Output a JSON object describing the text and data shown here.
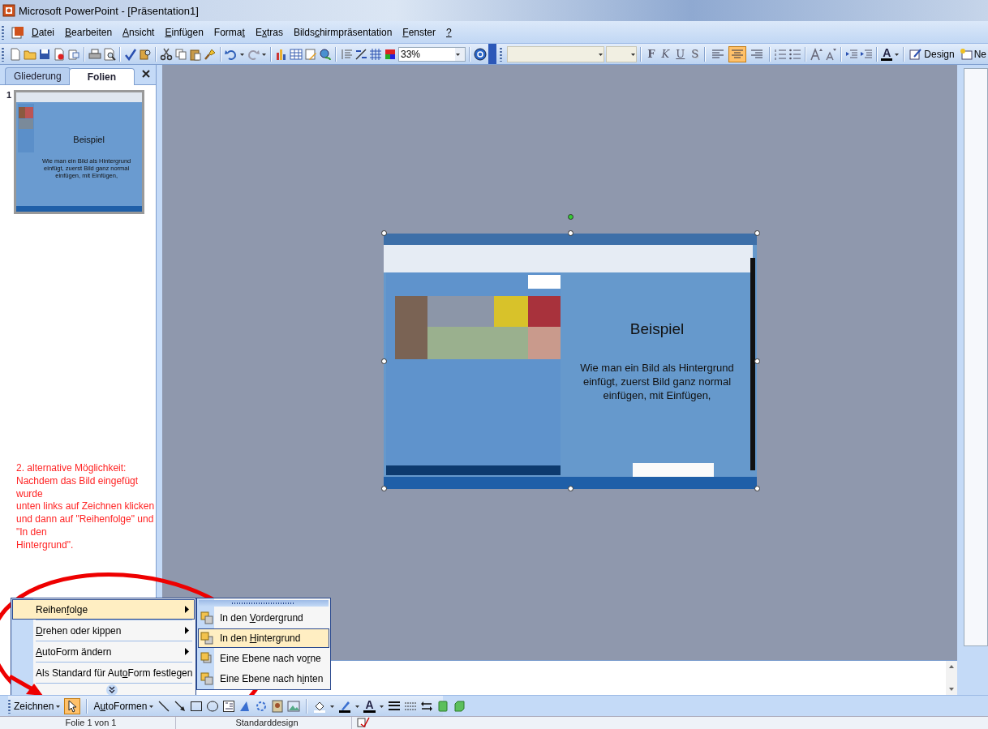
{
  "window": {
    "title": "Microsoft PowerPoint - [Präsentation1]"
  },
  "menu_bar": [
    {
      "parts": [
        {
          "text": "D",
          "access_key": true
        },
        {
          "text": "atei",
          "access_key": false
        }
      ]
    },
    {
      "parts": [
        {
          "text": "B",
          "access_key": true
        },
        {
          "text": "earbeiten",
          "access_key": false
        }
      ]
    },
    {
      "parts": [
        {
          "text": "A",
          "access_key": true
        },
        {
          "text": "nsicht",
          "access_key": false
        }
      ]
    },
    {
      "parts": [
        {
          "text": "E",
          "access_key": true
        },
        {
          "text": "infügen",
          "access_key": false
        }
      ]
    },
    {
      "parts": [
        {
          "text": "Forma",
          "access_key": false
        },
        {
          "text": "t",
          "access_key": true
        }
      ]
    },
    {
      "parts": [
        {
          "text": "E",
          "access_key": false
        },
        {
          "text": "x",
          "access_key": true
        },
        {
          "text": "tras",
          "access_key": false
        }
      ]
    },
    {
      "parts": [
        {
          "text": "Bilds",
          "access_key": false
        },
        {
          "text": "c",
          "access_key": true
        },
        {
          "text": "hirmpräsentation",
          "access_key": false
        }
      ]
    },
    {
      "parts": [
        {
          "text": "F",
          "access_key": true
        },
        {
          "text": "enster",
          "access_key": false
        }
      ]
    },
    {
      "parts": [
        {
          "text": "?",
          "access_key": true
        }
      ]
    }
  ],
  "standard_toolbar": {
    "zoom": "33%"
  },
  "formatting_toolbar": {
    "style_buttons": [
      {
        "label": "F",
        "kind": "bold"
      },
      {
        "label": "K",
        "kind": "italic"
      },
      {
        "label": "U",
        "kind": "underline"
      },
      {
        "label": "S",
        "kind": "shadow"
      }
    ],
    "alignment": [
      {
        "kind": "left",
        "selected": false
      },
      {
        "kind": "center",
        "selected": true
      },
      {
        "kind": "right",
        "selected": false
      }
    ],
    "font_color": "A",
    "design": "Design",
    "new_slide": "Ne"
  },
  "side_panel": {
    "tabs": [
      {
        "label": "Gliederung",
        "selected": false
      },
      {
        "label": "Folien",
        "selected": true
      }
    ],
    "thumbnail": {
      "number": "1",
      "title": "Beispiel",
      "body": "Wie man ein Bild als Hintergrund einfügt, zuerst Bild ganz normal einfügen, mit Einfügen,"
    },
    "note_lines": [
      "2. alternative Möglichkeit:",
      "Nachdem das Bild eingefügt",
      "wurde",
      "unten links auf Zeichnen klicken",
      "und dann auf \"Reihenfolge\" und",
      "\"In den",
      "Hintergrund\"."
    ]
  },
  "slide": {
    "title": "Beispiel",
    "body": "Wie man ein Bild als Hintergrund einfügt, zuerst Bild ganz normal einfügen, mit Einfügen,"
  },
  "context_menu": [
    {
      "kind": "submenu",
      "selected": true,
      "parts": [
        {
          "text": "Reihen",
          "access_key": false
        },
        {
          "text": "f",
          "access_key": true
        },
        {
          "text": "olge",
          "access_key": false
        }
      ]
    },
    {
      "kind": "submenu",
      "selected": false,
      "parts": [
        {
          "text": "D",
          "access_key": true
        },
        {
          "text": "rehen oder kippen",
          "access_key": false
        }
      ]
    },
    {
      "kind": "submenu",
      "selected": false,
      "parts": [
        {
          "text": "A",
          "access_key": true
        },
        {
          "text": "utoForm ändern",
          "access_key": false
        }
      ]
    },
    {
      "kind": "command",
      "selected": false,
      "parts": [
        {
          "text": "Als Standard für Aut",
          "access_key": false
        },
        {
          "text": "o",
          "access_key": true
        },
        {
          "text": "Form festlegen",
          "access_key": false
        }
      ]
    }
  ],
  "order_submenu": [
    {
      "kind": "front",
      "selected": false,
      "parts": [
        {
          "text": "In den ",
          "access_key": false
        },
        {
          "text": "V",
          "access_key": true
        },
        {
          "text": "ordergrund",
          "access_key": false
        }
      ]
    },
    {
      "kind": "back",
      "selected": true,
      "parts": [
        {
          "text": "In den ",
          "access_key": false
        },
        {
          "text": "H",
          "access_key": true
        },
        {
          "text": "intergrund",
          "access_key": false
        }
      ]
    },
    {
      "kind": "forward",
      "selected": false,
      "parts": [
        {
          "text": "Eine Ebene nach vo",
          "access_key": false
        },
        {
          "text": "r",
          "access_key": true
        },
        {
          "text": "ne",
          "access_key": false
        }
      ]
    },
    {
      "kind": "backward",
      "selected": false,
      "parts": [
        {
          "text": "Eine Ebene nach h",
          "access_key": false
        },
        {
          "text": "i",
          "access_key": true
        },
        {
          "text": "nten",
          "access_key": false
        }
      ]
    }
  ],
  "drawing_toolbar": {
    "draw": [
      {
        "text": "Zeichnen",
        "access_key": false
      }
    ],
    "pointer_selected": true,
    "autoshapes": [
      {
        "text": "A",
        "access_key": false
      },
      {
        "text": "u",
        "access_key": true
      },
      {
        "text": "toFormen",
        "access_key": false
      }
    ],
    "font_color": "A"
  },
  "status_bar": [
    "Folie 1 von 1",
    "Standarddesign"
  ]
}
